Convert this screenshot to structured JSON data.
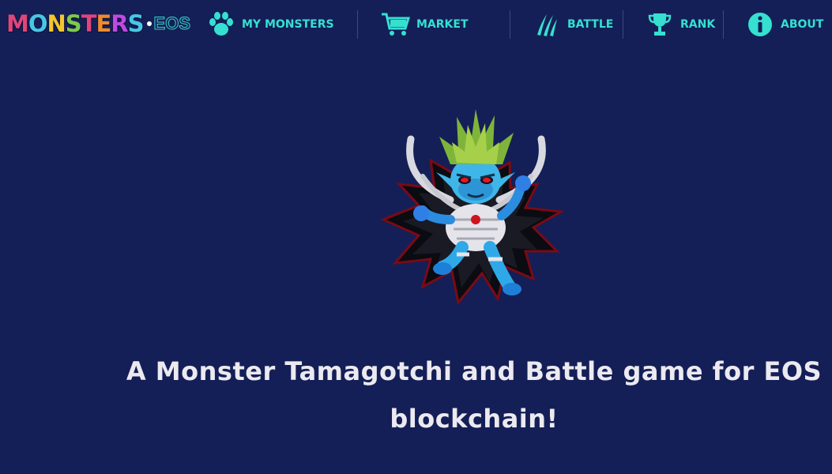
{
  "header": {
    "logo": {
      "word": "MONSTERS",
      "word_letters": [
        "M",
        "O",
        "N",
        "S",
        "T",
        "E",
        "R",
        "S"
      ],
      "letter_colors": [
        "#e0457b",
        "#49c6e5",
        "#f2c530",
        "#7ec94a",
        "#e0457b",
        "#f08a2c",
        "#c04ae0",
        "#49c6e5"
      ],
      "suffix": "EOS"
    },
    "nav": [
      {
        "label": "MY MONSTERS",
        "icon": "paw-icon"
      },
      {
        "label": "MARKET",
        "icon": "cart-icon"
      },
      {
        "label": "BATTLE",
        "icon": "claw-icon"
      },
      {
        "label": "RANK",
        "icon": "trophy-icon"
      },
      {
        "label": "ABOUT",
        "icon": "info-icon"
      }
    ]
  },
  "hero": {
    "image": "monster-illustration",
    "tagline": "A Monster Tamagotchi and Battle game for EOS blockchain!"
  },
  "colors": {
    "background": "#141f57",
    "accent": "#35e0d0",
    "text": "#eceaf0"
  }
}
